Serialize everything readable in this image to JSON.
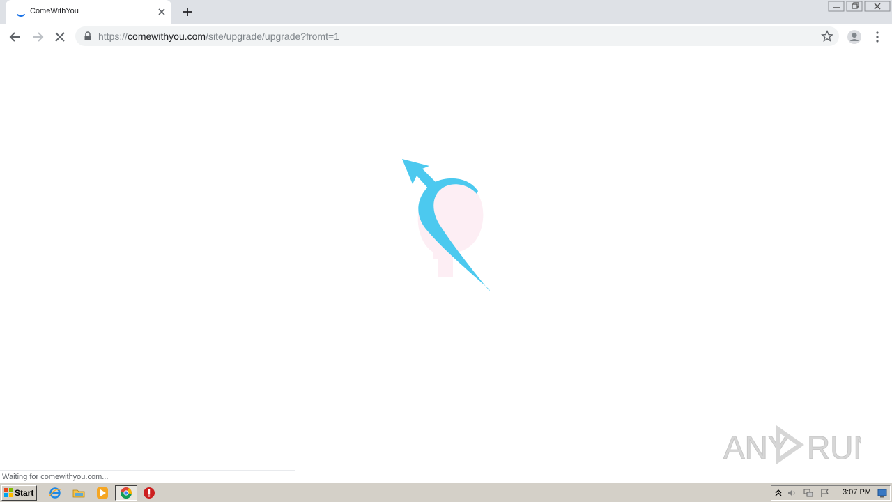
{
  "browser": {
    "tab": {
      "title": "ComeWithYou"
    },
    "address_bar": {
      "url_scheme": "https://",
      "url_domain": "comewithyou.com",
      "url_path": "/site/upgrade/upgrade?fromt=1"
    },
    "status_text": "Waiting for comewithyou.com..."
  },
  "watermark": {
    "left": "ANY",
    "right": "RUN"
  },
  "taskbar": {
    "start_label": "Start",
    "clock": "3:07 PM"
  },
  "colors": {
    "logo_blue": "#4cc9ef",
    "tab_strip": "#dee1e6",
    "omnibox": "#f1f3f4",
    "taskbar": "#d4d0c8"
  }
}
